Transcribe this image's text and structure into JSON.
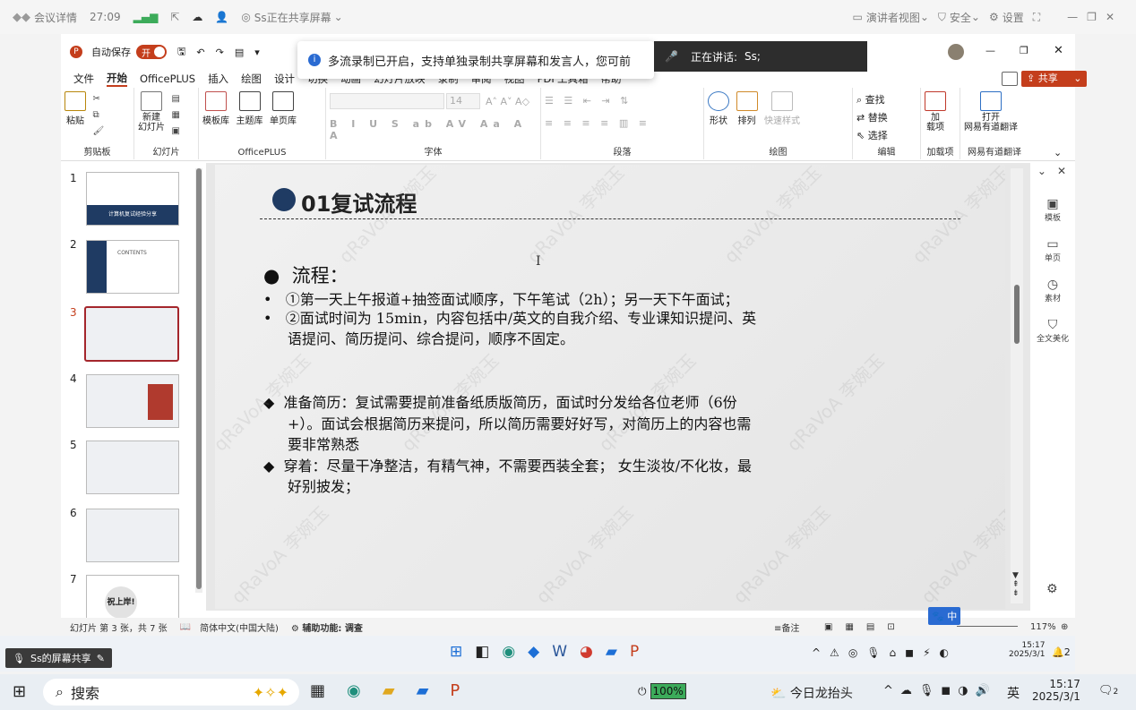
{
  "meeting_bar": {
    "details": "会议详情",
    "timer": "27:09",
    "sharing": "Ss正在共享屏幕",
    "presenter_view": "演讲者视图",
    "security": "安全",
    "settings": "设置"
  },
  "ppt": {
    "autosave_label": "自动保存",
    "autosave_state": "开",
    "share_button": "共享",
    "tabs": [
      "文件",
      "开始",
      "OfficePLUS",
      "插入",
      "绘图",
      "设计",
      "切换",
      "动画",
      "幻灯片放映",
      "录制",
      "审阅",
      "视图",
      "PDF工具箱",
      "帮助"
    ],
    "ribbon": {
      "paste": "粘贴",
      "clipboard": "剪贴板",
      "new_slide": "新建\n幻灯片",
      "slides_group": "幻灯片",
      "template_lib": "模板库",
      "theme_lib": "主题库",
      "single_page": "单页库",
      "officeplus_group": "OfficePLUS",
      "font_size": "14",
      "font_group": "字体",
      "paragraph_group": "段落",
      "shape": "形状",
      "arrange": "排列",
      "quick_style": "快速样式",
      "drawing_group": "绘图",
      "find": "查找",
      "replace": "替换",
      "select": "选择",
      "editing_group": "编辑",
      "addins": "加\n载项",
      "addins_group": "加载项",
      "open_translate": "打开\n网易有道翻译",
      "translate_group": "网易有道翻译"
    },
    "right_panel": [
      "模板",
      "单页",
      "素材",
      "全文美化"
    ],
    "thumbnails": [
      {
        "num": "1",
        "text": "计算机复试经验分享"
      },
      {
        "num": "2",
        "text": "CONTENTS"
      },
      {
        "num": "3",
        "text": ""
      },
      {
        "num": "4",
        "text": ""
      },
      {
        "num": "5",
        "text": ""
      },
      {
        "num": "6",
        "text": ""
      },
      {
        "num": "7",
        "text": "祝上岸!"
      }
    ],
    "slide": {
      "title": "01复试流程",
      "heading": "流程：",
      "bullet1": "①第一天上午报道+抽签面试顺序，下午笔试（2h）；另一天下午面试；",
      "bullet2a": "②面试时间为 15min，内容包括中/英文的自我介绍、专业课知识提问、英",
      "bullet2b": "语提问、简历提问、综合提问，顺序不固定。",
      "d1a": "准备简历：复试需要提前准备纸质版简历，面试时分发给各位老师（6份",
      "d1b": "+）。面试会根据简历来提问，所以简历需要好好写，对简历上的内容也需",
      "d1c": "要非常熟悉",
      "d2a": "穿着：尽量干净整洁，有精气神，不需要西装全套； 女生淡妆/不化妆，最",
      "d2b": "好别披发；",
      "watermark": "qRaVoA 李婉玉"
    },
    "status": {
      "slide_info": "幻灯片 第 3 张，共 7 张",
      "language": "简体中文(中国大陆)",
      "accessibility": "辅助功能: 调查",
      "notes": "备注",
      "zoom": "117%",
      "ime": "中"
    }
  },
  "toast": {
    "message": "多流录制已开启，支持单独录制共享屏幕和发言人，您可前"
  },
  "speaker": {
    "label": "正在讲话:",
    "name": "Ss;"
  },
  "share_badge": "Ss的屏幕共享",
  "inner_taskbar": {
    "time": "15:17",
    "date": "2025/3/1",
    "notif": "2"
  },
  "taskbar": {
    "search": "搜索",
    "battery": "100%",
    "weather": "今日龙抬头",
    "ime": "英",
    "time": "15:17",
    "date": "2025/3/1",
    "notif": "2"
  },
  "colors": {
    "accent": "#c43e1c",
    "slide_dot": "#1f3b63",
    "speaker_bg": "#2d2d2d"
  }
}
